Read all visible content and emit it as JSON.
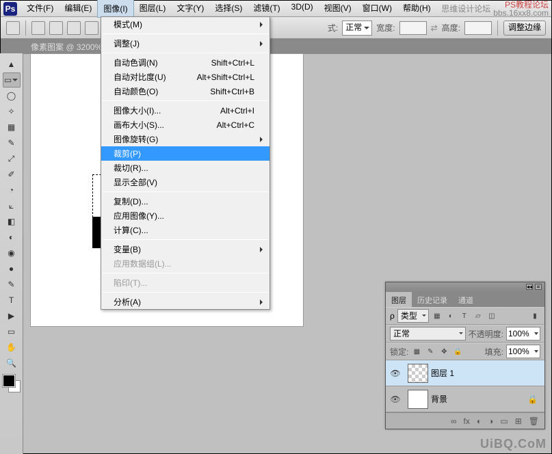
{
  "menubar": {
    "items": [
      "文件(F)",
      "编辑(E)",
      "图像(I)",
      "图层(L)",
      "文字(Y)",
      "选择(S)",
      "滤镜(T)",
      "3D(D)",
      "视图(V)",
      "窗口(W)",
      "帮助(H)"
    ],
    "activeIndex": 2,
    "tail": "思维设计论坛",
    "wm1": "PS教程论坛",
    "wm2": "bbs.16xx8.com"
  },
  "optbar": {
    "styleLabel": "式:",
    "styleValue": "正常",
    "widthLabel": "宽度:",
    "heightLabel": "高度:",
    "btn": "调整边缘"
  },
  "document": {
    "tab": "像素图案 @ 3200%"
  },
  "dropdown": {
    "groups": [
      [
        {
          "t": "模式(M)",
          "sub": true
        }
      ],
      [
        {
          "t": "调整(J)",
          "sub": true
        }
      ],
      [
        {
          "t": "自动色调(N)",
          "k": "Shift+Ctrl+L"
        },
        {
          "t": "自动对比度(U)",
          "k": "Alt+Shift+Ctrl+L"
        },
        {
          "t": "自动颜色(O)",
          "k": "Shift+Ctrl+B"
        }
      ],
      [
        {
          "t": "图像大小(I)...",
          "k": "Alt+Ctrl+I"
        },
        {
          "t": "画布大小(S)...",
          "k": "Alt+Ctrl+C"
        },
        {
          "t": "图像旋转(G)",
          "sub": true
        },
        {
          "t": "裁剪(P)",
          "hi": true
        },
        {
          "t": "裁切(R)..."
        },
        {
          "t": "显示全部(V)"
        }
      ],
      [
        {
          "t": "复制(D)..."
        },
        {
          "t": "应用图像(Y)..."
        },
        {
          "t": "计算(C)..."
        }
      ],
      [
        {
          "t": "变量(B)",
          "sub": true
        },
        {
          "t": "应用数据组(L)...",
          "dis": true
        }
      ],
      [
        {
          "t": "陷印(T)...",
          "dis": true
        }
      ],
      [
        {
          "t": "分析(A)",
          "sub": true
        }
      ]
    ]
  },
  "panel": {
    "tabs": [
      "图层",
      "历史记录",
      "通道"
    ],
    "filterLabel": "类型",
    "blend": "正常",
    "opacityLabel": "不透明度:",
    "opacity": "100%",
    "lockLabel": "锁定:",
    "fillLabel": "填充:",
    "fill": "100%",
    "layers": [
      {
        "name": "图层 1",
        "trans": true,
        "active": true
      },
      {
        "name": "背景",
        "locked": true
      }
    ],
    "foot": [
      "∞",
      "fx",
      "◐",
      "◑",
      "▭",
      "⊞",
      "🗑"
    ]
  },
  "tools": [
    "▲",
    "▭",
    "◯",
    "✧",
    "▦",
    "✎",
    "⤢",
    "✐",
    "◔",
    "⟀",
    "◧",
    "◐",
    "◉",
    "●",
    "✎",
    "T",
    "▶",
    "▭",
    "✋",
    "🔍"
  ],
  "watermark": "UiBQ.CoM"
}
